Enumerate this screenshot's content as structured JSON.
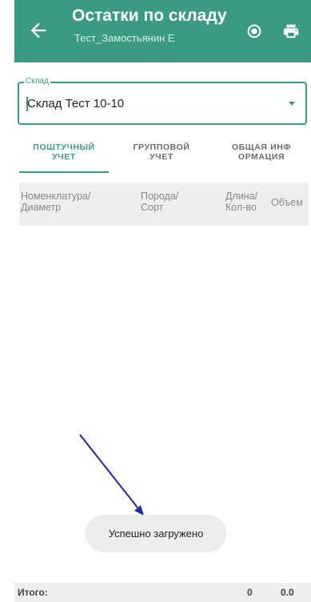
{
  "appbar": {
    "title": "Остатки по складу",
    "subtitle": "Тест_Замостьянин Е",
    "back_icon": "arrow-left-icon",
    "location_icon": "location-target-icon",
    "print_icon": "printer-icon",
    "background": "#3a9b82"
  },
  "warehouse_field": {
    "label": "Склад",
    "value": "Склад Тест 10-10",
    "dropdown_icon": "caret-down-icon"
  },
  "tabs": [
    {
      "line1": "ПОШТУЧНЫЙ",
      "line2": "УЧЕТ",
      "active": true
    },
    {
      "line1": "ГРУППОВОЙ",
      "line2": "УЧЕТ",
      "active": false
    },
    {
      "line1": "ОБЩАЯ ИНФ",
      "line2": "ОРМАЦИЯ",
      "active": false
    }
  ],
  "table": {
    "columns": [
      {
        "line1": "Номенклатура/",
        "line2": "Диаметр"
      },
      {
        "line1": "Порода/",
        "line2": "Сорт"
      },
      {
        "line1": "Длина/",
        "line2": "Кол-во"
      },
      {
        "line1": "Объем",
        "line2": ""
      }
    ]
  },
  "toast": {
    "text": "Успешно загружено"
  },
  "footer": {
    "label": "Итого:",
    "count": "0",
    "volume": "0.0"
  }
}
